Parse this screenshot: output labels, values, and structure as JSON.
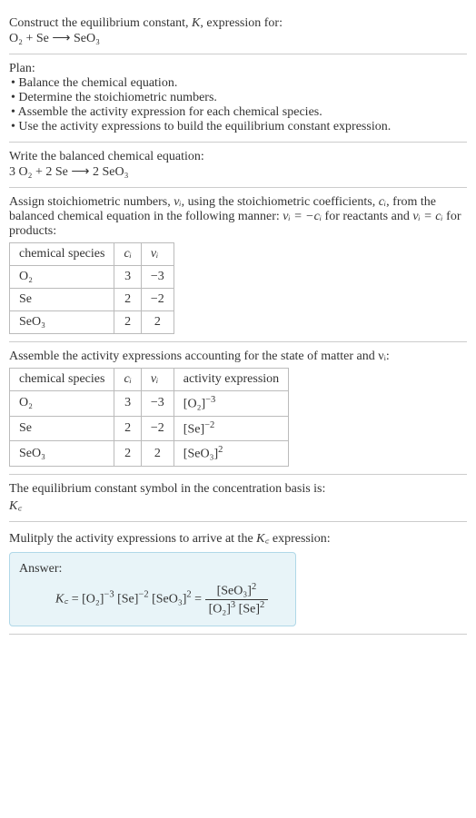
{
  "intro": {
    "line1": "Construct the equilibrium constant, ",
    "K": "K",
    "line1b": ", expression for:",
    "equation": "O₂ + Se ⟶ SeO₃"
  },
  "plan": {
    "title": "Plan:",
    "items": [
      "• Balance the chemical equation.",
      "• Determine the stoichiometric numbers.",
      "• Assemble the activity expression for each chemical species.",
      "• Use the activity expressions to build the equilibrium constant expression."
    ]
  },
  "balanced": {
    "title": "Write the balanced chemical equation:",
    "equation": "3 O₂ + 2 Se ⟶ 2 SeO₃"
  },
  "stoich": {
    "intro1": "Assign stoichiometric numbers, ",
    "nu_i": "νᵢ",
    "intro2": ", using the stoichiometric coefficients, ",
    "c_i": "cᵢ",
    "intro3": ", from the balanced chemical equation in the following manner: ",
    "rule1": "νᵢ = −cᵢ",
    "intro4": " for reactants and ",
    "rule2": "νᵢ = cᵢ",
    "intro5": " for products:",
    "headers": [
      "chemical species",
      "cᵢ",
      "νᵢ"
    ],
    "rows": [
      {
        "species": "O₂",
        "c": "3",
        "nu": "−3"
      },
      {
        "species": "Se",
        "c": "2",
        "nu": "−2"
      },
      {
        "species": "SeO₃",
        "c": "2",
        "nu": "2"
      }
    ]
  },
  "activity": {
    "title": "Assemble the activity expressions accounting for the state of matter and νᵢ:",
    "headers": [
      "chemical species",
      "cᵢ",
      "νᵢ",
      "activity expression"
    ],
    "rows": [
      {
        "species": "O₂",
        "c": "3",
        "nu": "−3",
        "expr_base": "[O₂]",
        "expr_pow": "−3"
      },
      {
        "species": "Se",
        "c": "2",
        "nu": "−2",
        "expr_base": "[Se]",
        "expr_pow": "−2"
      },
      {
        "species": "SeO₃",
        "c": "2",
        "nu": "2",
        "expr_base": "[SeO₃]",
        "expr_pow": "2"
      }
    ]
  },
  "symbol": {
    "title": "The equilibrium constant symbol in the concentration basis is:",
    "Kc": "K꜀"
  },
  "multiply": {
    "title": "Mulitply the activity expressions to arrive at the ",
    "Kc": "K꜀",
    "title2": " expression:"
  },
  "answer": {
    "label": "Answer:",
    "Kc": "K꜀",
    "eq": " = ",
    "t1": "[O₂]",
    "p1": "−3",
    "t2": " [Se]",
    "p2": "−2",
    "t3": " [SeO₃]",
    "p3": "2",
    "eq2": " = ",
    "num_base": "[SeO₃]",
    "num_pow": "2",
    "den1_base": "[O₂]",
    "den1_pow": "3",
    "den2_base": " [Se]",
    "den2_pow": "2"
  }
}
